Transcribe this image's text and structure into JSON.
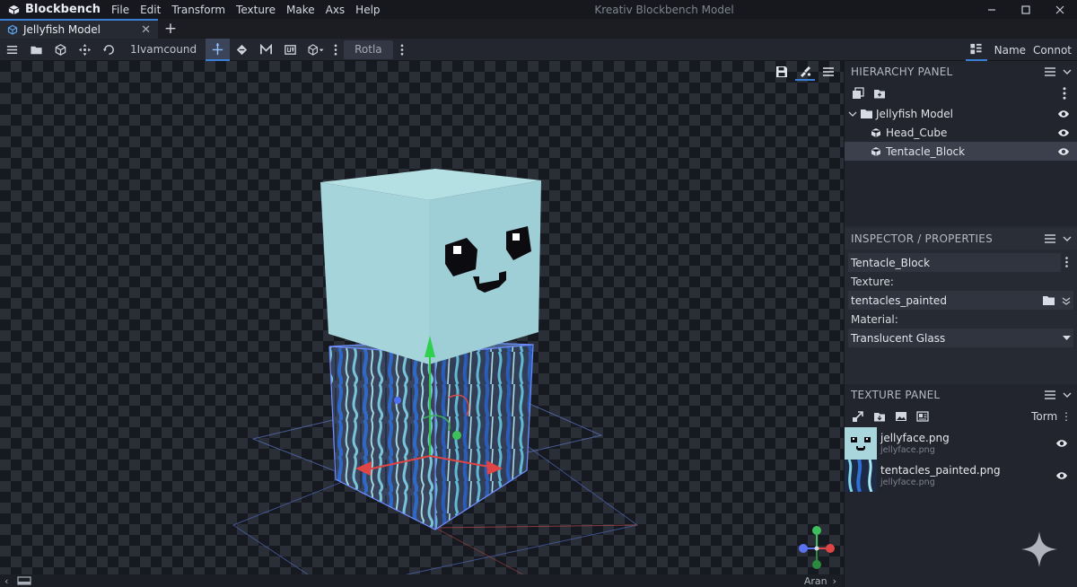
{
  "app": {
    "name": "Blockbench",
    "window_title": "Kreativ Blockbench Model",
    "menu": [
      "File",
      "Edit",
      "Transform",
      "Texture",
      "Make",
      "Axs",
      "Help"
    ],
    "window_controls": [
      "minimize-icon",
      "maximize-icon",
      "close-icon"
    ]
  },
  "tabs": {
    "active_label": "Jellyfish Model",
    "close_symbol": "✕",
    "new_symbol": "+"
  },
  "toolbar": {
    "mode_label": "1Ivamcound",
    "rotla_label": "Rotla",
    "right_name": "Name",
    "right_connot": "Connot"
  },
  "hierarchy": {
    "title": "HIERARCHY PANEL",
    "root": "Jellyfish Model",
    "children": [
      "Head_Cube",
      "Tentacle_Block"
    ],
    "selected": "Tentacle_Block"
  },
  "inspector": {
    "title": "INSPECTOR / PROPERTIES",
    "object_name": "Tentacle_Block",
    "texture_label": "Texture:",
    "texture_value": "tentacles_painted",
    "material_label": "Material:",
    "material_value": "Translucent Glass"
  },
  "textures": {
    "title": "TEXTURE PANEL",
    "tools_label": "Torm",
    "items": [
      {
        "name": "jellyface.png",
        "sub": "jellyface.png"
      },
      {
        "name": "tentacles_painted.png",
        "sub": "jellyface.png"
      }
    ]
  },
  "status": {
    "right_label": "Aran"
  },
  "colors": {
    "accent": "#3a7fd6",
    "head_cube": "#a9d6dc",
    "selection": "#3b404c"
  }
}
